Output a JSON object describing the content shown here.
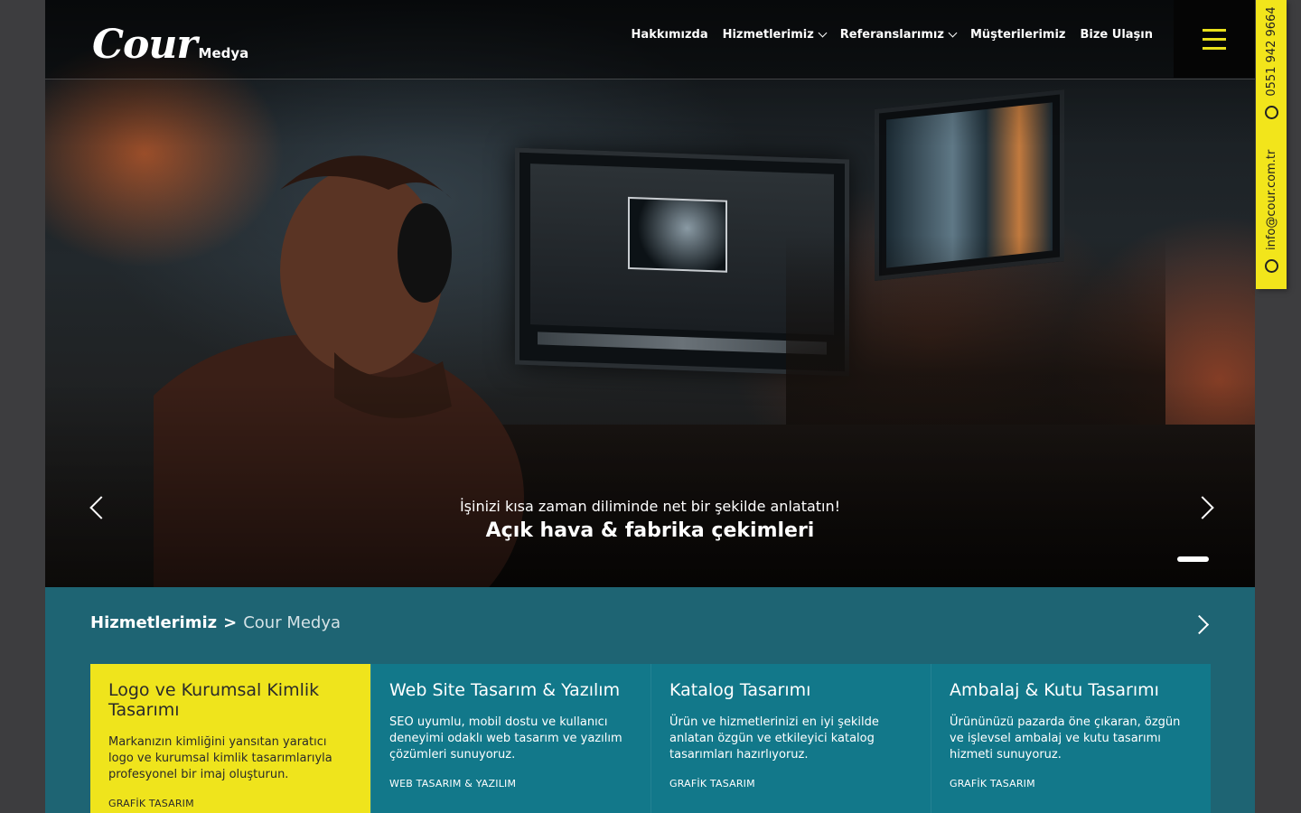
{
  "brand": {
    "logo_main": "Cour",
    "logo_sub": "Medya"
  },
  "nav": {
    "items": [
      {
        "label": "Hakkımızda"
      },
      {
        "label": "Hizmetlerimiz"
      },
      {
        "label": "Referanslarımız"
      },
      {
        "label": "Müşterilerimiz"
      },
      {
        "label": "Bize Ulaşın"
      }
    ]
  },
  "hero": {
    "subtitle": "İşinizi kısa zaman diliminde net bir şekilde anlatatın!",
    "title": "Açık hava & fabrika çekimleri"
  },
  "contact": {
    "email": "info@cour.com.tr",
    "phone": "0551 942 9664"
  },
  "services": {
    "breadcrumb_root": "Hizmetlerimiz",
    "breadcrumb_sep": ">",
    "breadcrumb_current": "Cour Medya",
    "cards": [
      {
        "title": "Logo ve Kurumsal Kimlik Tasarımı",
        "desc": "Markanızın kimliğini yansıtan yaratıcı logo ve kurumsal kimlik tasarımlarıyla profesyonel bir imaj oluşturun.",
        "tag": "GRAFİK TASARIM"
      },
      {
        "title": "Web Site Tasarım & Yazılım",
        "desc": "SEO uyumlu, mobil dostu ve kullanıcı deneyimi odaklı web tasarım ve yazılım çözümleri sunuyoruz.",
        "tag": "WEB TASARIM & YAZILIM"
      },
      {
        "title": "Katalog Tasarımı",
        "desc": "Ürün ve hizmetlerinizi en iyi şekilde anlatan özgün ve etkileyici katalog tasarımları hazırlıyoruz.",
        "tag": "GRAFİK TASARIM"
      },
      {
        "title": "Ambalaj & Kutu Tasarımı",
        "desc": "Ürününüzü pazarda öne çıkaran, özgün ve işlevsel ambalaj ve kutu tasarımı hizmeti sunuyoruz.",
        "tag": "GRAFİK TASARIM"
      }
    ]
  },
  "colors": {
    "accent": "#efe41c",
    "section_bg": "#1e6473",
    "card_bg": "#12788a"
  },
  "icons": {
    "email": "at-icon",
    "phone": "whatsapp-icon",
    "menu": "hamburger-icon",
    "prev": "chevron-left-icon",
    "next": "chevron-right-icon"
  }
}
